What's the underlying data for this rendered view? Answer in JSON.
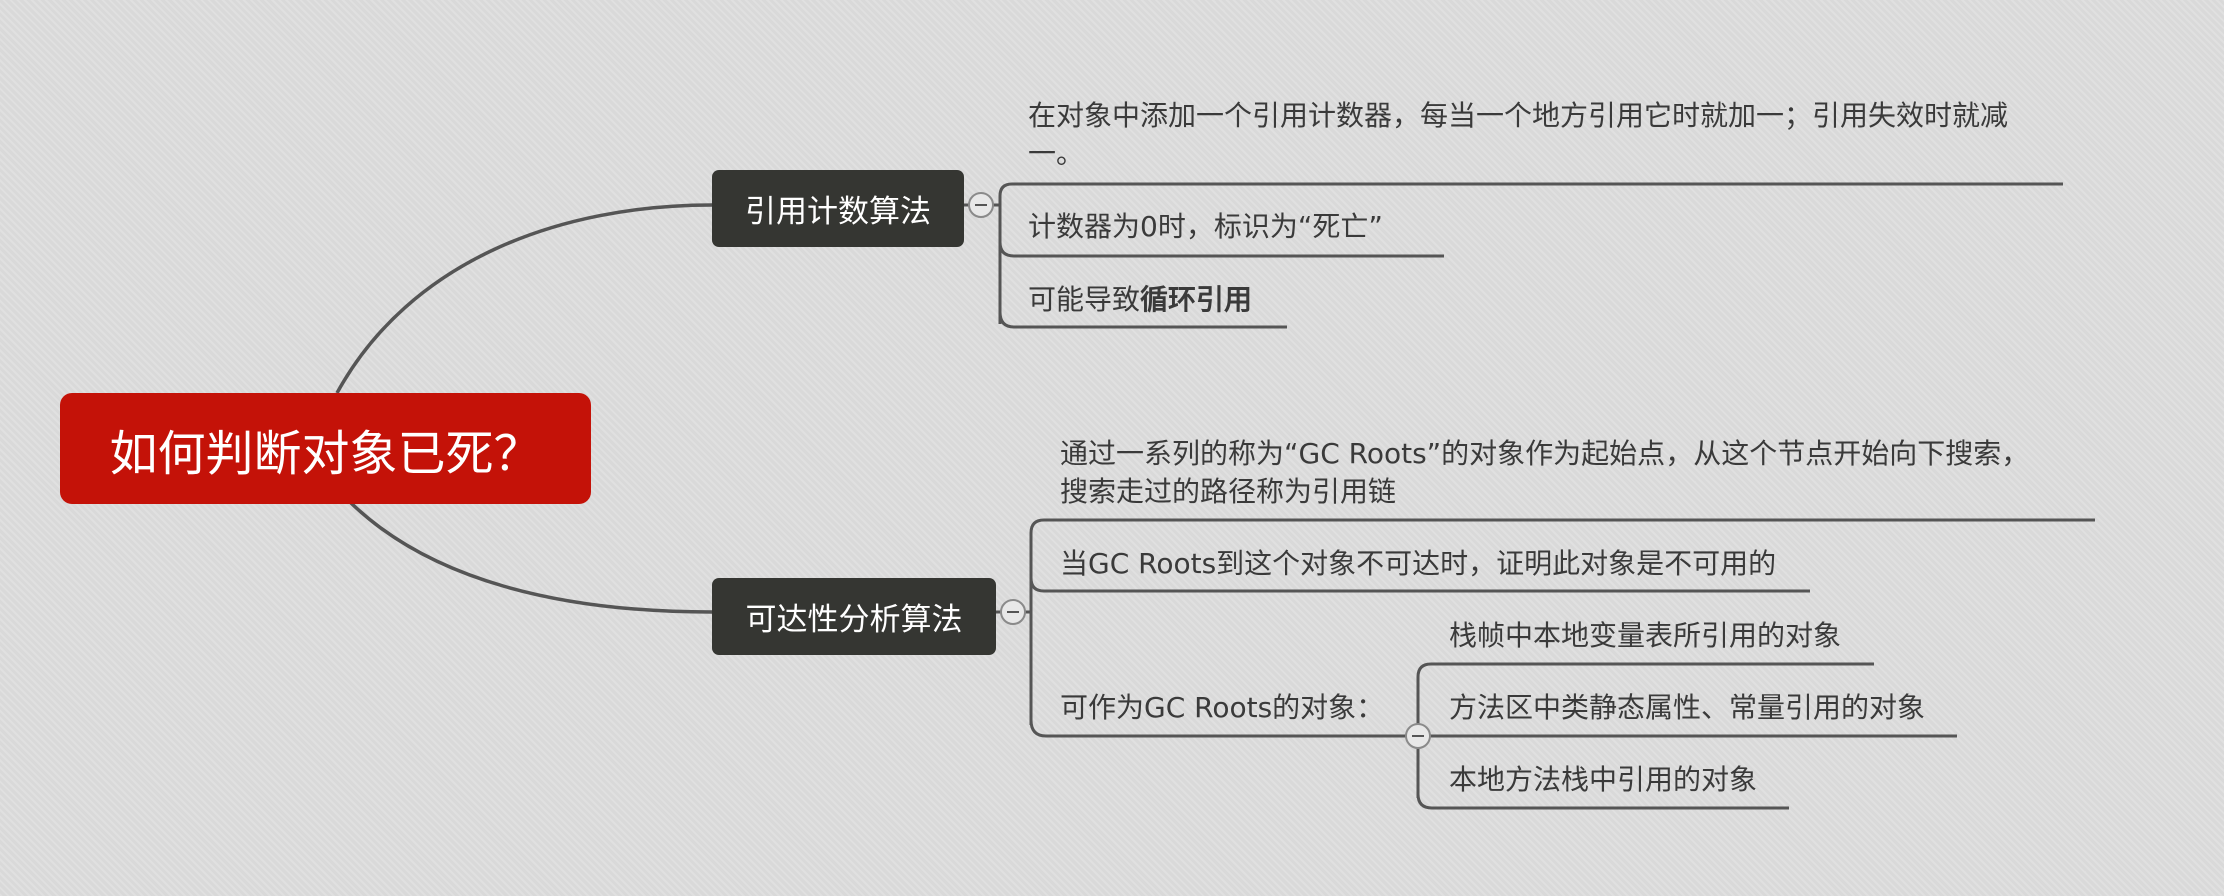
{
  "root": {
    "label": "如何判断对象已死？"
  },
  "branches": [
    {
      "label": "引用计数算法",
      "children": [
        {
          "line1": "在对象中添加一个引用计数器，每当一个地方引用它时就加一；引用失效时就减",
          "line2": "一。"
        },
        {
          "text": "计数器为0时，标识为“死亡”"
        },
        {
          "prefix": "可能导致",
          "bold": "循环引用"
        }
      ]
    },
    {
      "label": "可达性分析算法",
      "children": [
        {
          "line1": "通过一系列的称为“GC Roots”的对象作为起始点，从这个节点开始向下搜索，",
          "line2": "搜索走过的路径称为引用链"
        },
        {
          "text": "当GC Roots到这个对象不可达时，证明此对象是不可用的"
        },
        {
          "text": "可作为GC Roots的对象：",
          "children": [
            {
              "text": "栈帧中本地变量表所引用的对象"
            },
            {
              "text": "方法区中类静态属性、常量引用的对象"
            },
            {
              "text": "本地方法栈中引用的对象"
            }
          ]
        }
      ]
    }
  ],
  "colors": {
    "root": "#c41208",
    "branch": "#353632",
    "line": "#555555",
    "background": "#dcdcdc"
  }
}
